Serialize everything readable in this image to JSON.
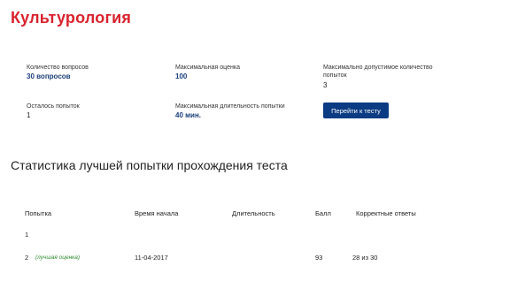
{
  "page": {
    "title": "Культурология"
  },
  "info": {
    "questions_label": "Количество вопросов",
    "questions_value": "30 вопросов",
    "max_score_label": "Максимальная оценка",
    "max_score_value": "100",
    "max_attempts_label": "Максимально допустимое количество попыток",
    "max_attempts_value": "3",
    "remaining_label": "Осталось попыток",
    "remaining_value": "1",
    "max_duration_label": "Максимальная длительность попытки",
    "max_duration_value": "40 мин.",
    "go_button_label": "Перейти к тесту"
  },
  "stats": {
    "title": "Статистика лучшей попытки прохождения теста",
    "columns": [
      "Попытка",
      "Время начала",
      "Длительность",
      "Балл",
      "Корректные ответы"
    ],
    "rows": [
      {
        "attempt": "1",
        "best_label": "",
        "start": "",
        "duration": "",
        "score": "",
        "correct": ""
      },
      {
        "attempt": "2",
        "best_label": "(лучшая оценка)",
        "start": "11-04-2017",
        "duration": "",
        "score": "93",
        "correct": "28 из 30"
      }
    ]
  },
  "colors": {
    "title": "#d9232e",
    "accent_button": "#0b3b82",
    "value_text": "#1b3f7a",
    "best_label": "#2a8a2a"
  }
}
